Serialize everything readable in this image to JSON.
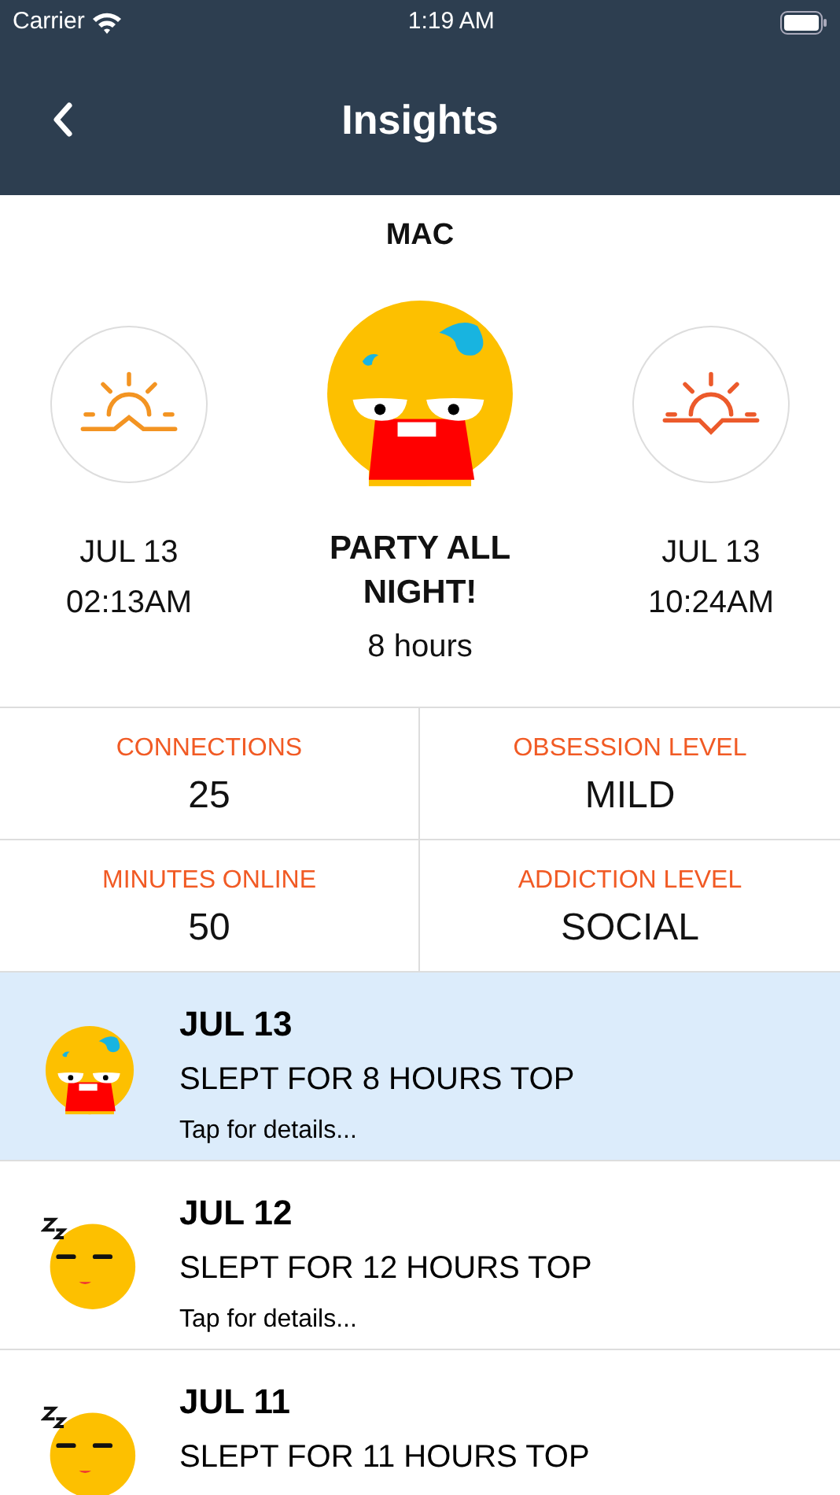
{
  "status_bar": {
    "carrier": "Carrier",
    "time": "1:19 AM"
  },
  "nav": {
    "title": "Insights"
  },
  "profile": {
    "name": "MAC"
  },
  "sleep": {
    "start": {
      "kind": "sunrise",
      "date": "JUL 13",
      "time": "02:13AM"
    },
    "summary": {
      "kind": "party",
      "title": "PARTY ALL NIGHT!",
      "duration": "8 hours"
    },
    "end": {
      "kind": "sunset",
      "date": "JUL 13",
      "time": "10:24AM"
    }
  },
  "stats": [
    {
      "label": "CONNECTIONS",
      "value": "25"
    },
    {
      "label": "OBSESSION LEVEL",
      "value": "MILD"
    },
    {
      "label": "MINUTES ONLINE",
      "value": "50"
    },
    {
      "label": "ADDICTION LEVEL",
      "value": "SOCIAL"
    }
  ],
  "entries": [
    {
      "kind": "party",
      "date": "JUL 13",
      "summary": "SLEPT FOR 8 HOURS TOP",
      "detail": "Tap for details...",
      "selected": true
    },
    {
      "kind": "sleepy",
      "date": "JUL 12",
      "summary": "SLEPT FOR 12 HOURS TOP",
      "detail": "Tap for details...",
      "selected": false
    },
    {
      "kind": "sleepy",
      "date": "JUL 11",
      "summary": "SLEPT FOR 11 HOURS TOP",
      "selected": false
    }
  ]
}
